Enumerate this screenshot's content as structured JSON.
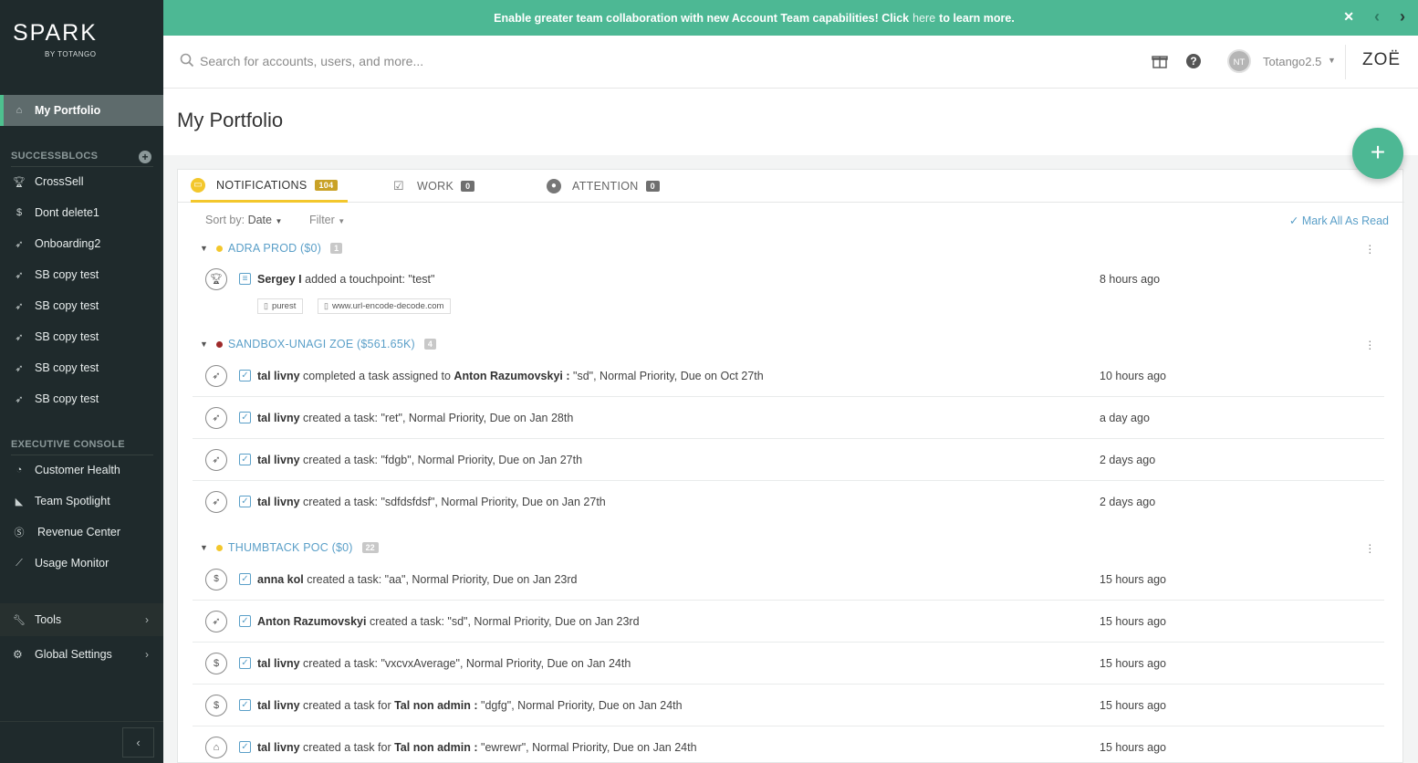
{
  "brand": {
    "logo_main": "SPARK",
    "logo_sub": "BY TOTANGO"
  },
  "sidebar": {
    "active_item": {
      "label": "My Portfolio",
      "icon": "home-icon"
    },
    "successblocs_label": "SUCCESSBLOCS",
    "successblocs": [
      {
        "label": "CrossSell",
        "icon": "trophy-icon"
      },
      {
        "label": "Dont delete1",
        "icon": "dollar-icon"
      },
      {
        "label": "Onboarding2",
        "icon": "rocket-icon"
      },
      {
        "label": "SB copy test",
        "icon": "rocket-icon"
      },
      {
        "label": "SB copy test",
        "icon": "rocket-icon"
      },
      {
        "label": "SB copy test",
        "icon": "rocket-icon"
      },
      {
        "label": "SB copy test",
        "icon": "rocket-icon"
      },
      {
        "label": "SB copy test",
        "icon": "rocket-icon"
      }
    ],
    "executive_label": "EXECUTIVE CONSOLE",
    "executive": [
      {
        "label": "Customer Health",
        "icon": "health-icon"
      },
      {
        "label": "Team Spotlight",
        "icon": "spotlight-icon"
      },
      {
        "label": "Revenue Center",
        "icon": "revenue-icon"
      },
      {
        "label": "Usage Monitor",
        "icon": "chart-icon"
      }
    ],
    "tools_label": "Tools",
    "global_settings_label": "Global Settings"
  },
  "banner": {
    "text_before": "Enable greater team collaboration with new Account Team capabilities! Click",
    "link": "here",
    "text_after": "to learn more."
  },
  "header": {
    "search_placeholder": "Search for accounts, users, and more...",
    "avatar_initials": "NT",
    "user_name": "Totango2.5",
    "zoe_label": "ZOË"
  },
  "page": {
    "title": "My Portfolio"
  },
  "tabs": [
    {
      "label": "NOTIFICATIONS",
      "count": "104"
    },
    {
      "label": "WORK",
      "count": "0"
    },
    {
      "label": "ATTENTION",
      "count": "0"
    }
  ],
  "toolbar": {
    "sort_label": "Sort by:",
    "sort_value": "Date",
    "filter_label": "Filter",
    "mark_all_label": "Mark All As Read"
  },
  "groups": [
    {
      "account": "ADRA PROD ($0)",
      "count": "1",
      "dot_color": "#f3c72c",
      "items": [
        {
          "icon": "trophy-icon",
          "actor": "Sergey I",
          "text": "added a touchpoint: \"test\"",
          "time": "8 hours ago",
          "attachments": [
            "purest",
            "www.url-encode-decode.com"
          ]
        }
      ]
    },
    {
      "account": "SANDBOX-UNAGI ZOE ($561.65K)",
      "count": "4",
      "dot_color": "#9e2a2a",
      "items": [
        {
          "icon": "rocket-icon",
          "actor": "tal livny",
          "text_a": "completed a task assigned to",
          "target": "Anton Razumovskyi :",
          "text": "\"sd\", Normal Priority, Due on Oct 27th",
          "time": "10 hours ago"
        },
        {
          "icon": "rocket-icon",
          "actor": "tal livny",
          "text": "created a task: \"ret\", Normal Priority, Due on Jan 28th",
          "time": "a day ago"
        },
        {
          "icon": "rocket-icon",
          "actor": "tal livny",
          "text": "created a task: \"fdgb\", Normal Priority, Due on Jan 27th",
          "time": "2 days ago"
        },
        {
          "icon": "rocket-icon",
          "actor": "tal livny",
          "text": "created a task: \"sdfdsfdsf\", Normal Priority, Due on Jan 27th",
          "time": "2 days ago"
        }
      ]
    },
    {
      "account": "THUMBTACK POC ($0)",
      "count": "22",
      "dot_color": "#f3c72c",
      "items": [
        {
          "icon": "bill-icon",
          "actor": "anna kol",
          "text": "created a task: \"aa\", Normal Priority, Due on Jan 23rd",
          "time": "15 hours ago"
        },
        {
          "icon": "rocket-icon",
          "actor": "Anton Razumovskyi",
          "text": "created a task: \"sd\", Normal Priority, Due on Jan 23rd",
          "time": "15 hours ago"
        },
        {
          "icon": "dollar-icon",
          "actor": "tal livny",
          "text": "created a task: \"vxcvxAverage\", Normal Priority, Due on Jan 24th",
          "time": "15 hours ago"
        },
        {
          "icon": "dollar-icon",
          "actor": "tal livny",
          "text_a": "created a task for",
          "target": "Tal non admin :",
          "text": "\"dgfg\", Normal Priority, Due on Jan 24th",
          "time": "15 hours ago"
        },
        {
          "icon": "bank-icon",
          "actor": "tal livny",
          "text_a": "created a task for",
          "target": "Tal non admin :",
          "text": "\"ewrewr\", Normal Priority, Due on Jan 24th",
          "time": "15 hours ago"
        }
      ]
    }
  ],
  "colors": {
    "accent": "#4db894",
    "sidebar_bg": "#1f2a2c",
    "link": "#5a9fc8",
    "tab_active": "#f3c72c"
  }
}
